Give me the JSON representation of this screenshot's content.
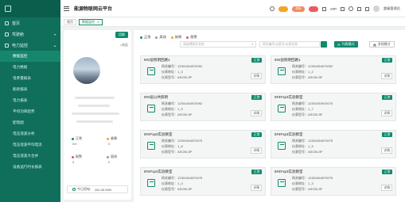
{
  "header": {
    "title": "能源物联网云平台",
    "pills": [
      {
        "label": "",
        "color": "#f5a623",
        "badge": ""
      },
      {
        "label": "资料",
        "color": "#f08a5d",
        "badge": ""
      },
      {
        "label": "",
        "color": "#ec5b5b",
        "badge": ""
      }
    ],
    "app_label": "APP",
    "user_name": "超级管理员"
  },
  "tabs": [
    {
      "label": "首页",
      "active": false
    },
    {
      "label": "数据监控",
      "active": true
    }
  ],
  "sidebar": {
    "items": [
      {
        "label": "首页",
        "type": "top"
      },
      {
        "label": "驾驶舱",
        "type": "top"
      },
      {
        "label": "电力监控",
        "type": "top"
      }
    ],
    "sub_items": [
      {
        "label": "数据监控",
        "active": true
      },
      {
        "label": "电力数据",
        "active": false
      },
      {
        "label": "电参量报表",
        "active": false
      },
      {
        "label": "能耗报表",
        "active": false
      },
      {
        "label": "电力报表",
        "active": false
      },
      {
        "label": "平均功率趋势",
        "active": false
      },
      {
        "label": "配电图",
        "active": false
      },
      {
        "label": "电压谐波分析",
        "active": false
      },
      {
        "label": "电压谐波平均电流",
        "active": false
      },
      {
        "label": "电压谐波大合并",
        "active": false
      },
      {
        "label": "设备运行时长报表",
        "active": false
      }
    ]
  },
  "left_panel": {
    "top_button": "切换",
    "back_label": "<收起",
    "stats": {
      "normal_label": "正常",
      "normal_value": "0/0",
      "fault_label": "故障",
      "fault_value": "0",
      "alarm_label": "报警",
      "alarm_value": "0",
      "offline_label": "离线",
      "offline_value": "0"
    },
    "today_label": "今日用电：",
    "today_value": "262.45 kWh"
  },
  "legend": [
    {
      "label": "正常",
      "color": "#0f8a6c"
    },
    {
      "label": "离线",
      "color": "#999999"
    },
    {
      "label": "故障",
      "color": "#f5a623"
    },
    {
      "label": "报警",
      "color": "#e05555"
    }
  ],
  "filters": {
    "select1_placeholder": "请选择网关名称",
    "select2_placeholder": "网关编号/仪表号/仪表名称",
    "list_mode_label": "列表模式",
    "multi_mode_label": "多视模式"
  },
  "cards": [
    {
      "title": "5#2层照明回路1",
      "status": "正常",
      "gateway_label": "网关编号：",
      "gateway": "12301064970092",
      "addr_label": "仪表地址：",
      "addr": "1_3",
      "model_label": "仪表型号：",
      "model": "ASCBI-3P",
      "detail": "详情"
    },
    {
      "title": "5#2层照明回路1",
      "status": "正常",
      "gateway_label": "网关编号：",
      "gateway": "12301064970092",
      "addr_label": "仪表地址：",
      "addr": "1_2",
      "model_label": "仪表型号：",
      "model": "ASCBI-3P",
      "detail": "详情"
    },
    {
      "title": "5#2层公共照明",
      "status": "正常",
      "gateway_label": "网关编号：",
      "gateway": "12301064970092",
      "addr_label": "仪表地址：",
      "addr": "1_5",
      "model_label": "仪表型号：",
      "model": "ASCBI-3P",
      "detail": "详情"
    },
    {
      "title": "5#4Fxp3实验教室",
      "status": "正常",
      "gateway_label": "网关编号：",
      "gateway": "12301064970075",
      "addr_label": "仪表地址：",
      "addr": "1_7",
      "model_label": "仪表型号：",
      "model": "ASCBI-3P",
      "detail": "详情"
    },
    {
      "title": "5#4Fxp3实验教室",
      "status": "正常",
      "gateway_label": "网关编号：",
      "gateway": "12301064970075",
      "addr_label": "仪表地址：",
      "addr": "1_6",
      "model_label": "仪表型号：",
      "model": "ASCBI-3P",
      "detail": "详情"
    },
    {
      "title": "5#4Fxp3实验教室",
      "status": "正常",
      "gateway_label": "网关编号：",
      "gateway": "12301064970075",
      "addr_label": "仪表地址：",
      "addr": "1_5",
      "model_label": "仪表型号：",
      "model": "ASCBI-3P",
      "detail": "详情"
    },
    {
      "title": "5#4Fxp3实验教室",
      "status": "正常",
      "gateway_label": "网关编号：",
      "gateway": "12301064970075",
      "addr_label": "仪表地址：",
      "addr": "1_4",
      "model_label": "仪表型号：",
      "model": "ASCBI-3P",
      "detail": "详情"
    },
    {
      "title": "5#4Fxp3实验教室",
      "status": "正常",
      "gateway_label": "网关编号：",
      "gateway": "12301064970075",
      "addr_label": "仪表地址：",
      "addr": "1_3",
      "model_label": "仪表型号：",
      "model": "ASCBI-3P",
      "detail": "详情"
    }
  ]
}
